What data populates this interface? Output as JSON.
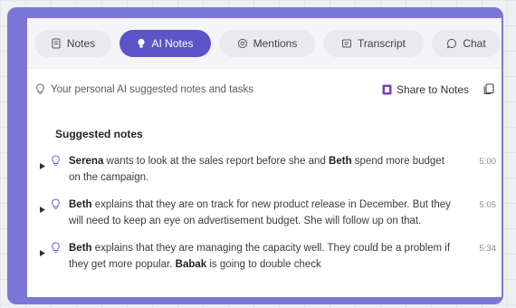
{
  "tabs": [
    {
      "label": "Notes",
      "icon": "notes-icon"
    },
    {
      "label": "AI Notes",
      "icon": "lightbulb-icon",
      "active": true
    },
    {
      "label": "Mentions",
      "icon": "at-icon"
    },
    {
      "label": "Transcript",
      "icon": "transcript-icon"
    },
    {
      "label": "Chat",
      "icon": "chat-icon"
    }
  ],
  "banner": {
    "hint": "Your personal AI suggested notes and tasks",
    "share_label": "Share to Notes"
  },
  "section_title": "Suggested notes",
  "notes": [
    {
      "time": "5:00",
      "parts": [
        {
          "t": "Serena",
          "b": true
        },
        {
          "t": " wants to look at the sales report before she and "
        },
        {
          "t": "Beth",
          "b": true
        },
        {
          "t": " spend more budget on the campaign."
        }
      ]
    },
    {
      "time": "5:05",
      "parts": [
        {
          "t": "Beth",
          "b": true
        },
        {
          "t": " explains that they are on track for new product release in December. But they will need to keep an eye on advertisement budget. She will follow up on that."
        }
      ]
    },
    {
      "time": "5:34",
      "parts": [
        {
          "t": "Beth",
          "b": true
        },
        {
          "t": " explains that they are managing the capacity well. They could be a problem if they get more popular. "
        },
        {
          "t": "Babak",
          "b": true
        },
        {
          "t": " is going to double check"
        }
      ]
    }
  ],
  "colors": {
    "accent": "#5b55c9",
    "frame": "#7b76d6",
    "share_icon": "#7b3fb5"
  }
}
